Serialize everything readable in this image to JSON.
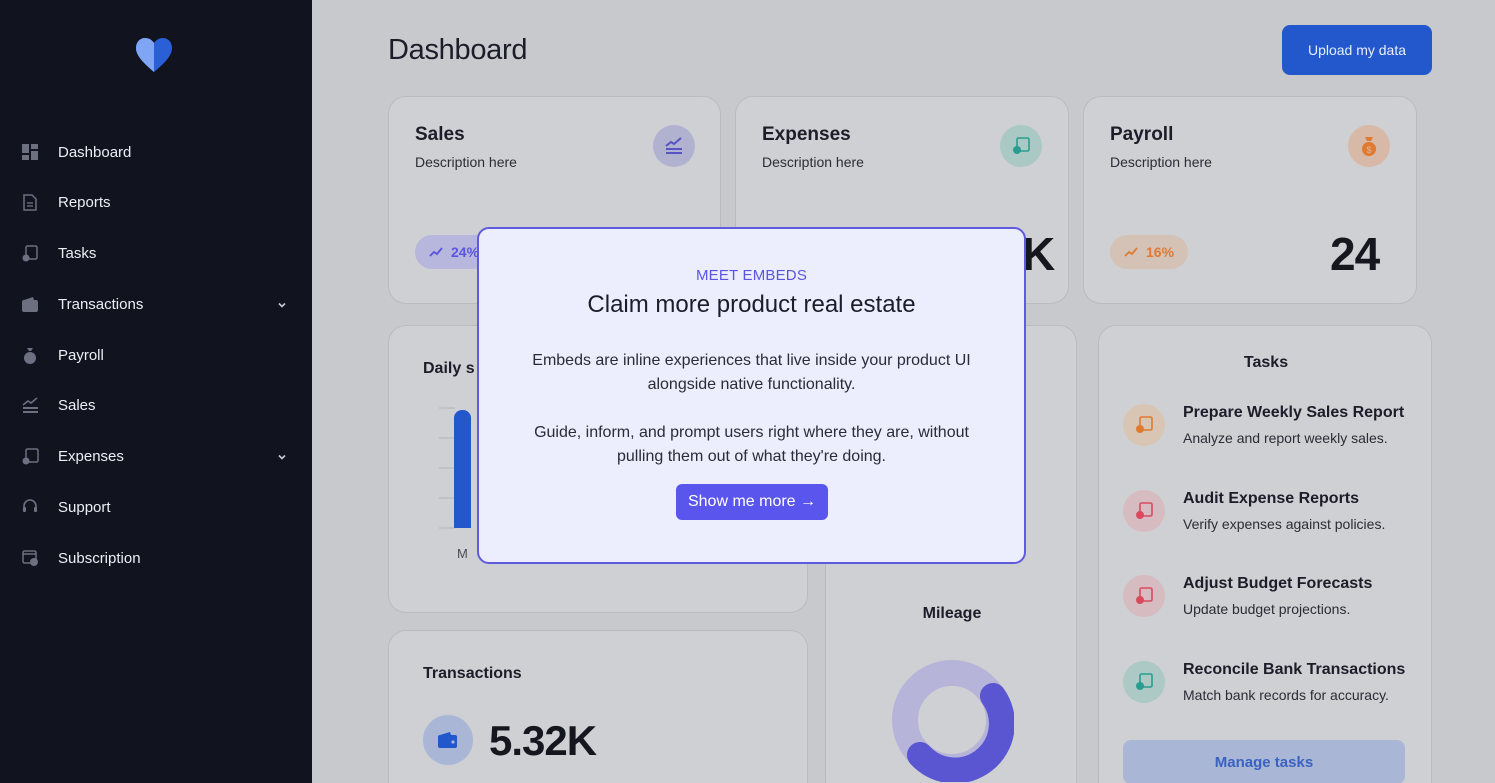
{
  "sidebar": {
    "items": [
      {
        "label": "Dashboard",
        "icon": "dashboard-icon"
      },
      {
        "label": "Reports",
        "icon": "document-icon"
      },
      {
        "label": "Tasks",
        "icon": "tasks-icon"
      },
      {
        "label": "Transactions",
        "icon": "wallet-icon",
        "expandable": true
      },
      {
        "label": "Payroll",
        "icon": "money-bag-icon"
      },
      {
        "label": "Sales",
        "icon": "chart-icon"
      },
      {
        "label": "Expenses",
        "icon": "expenses-icon",
        "expandable": true
      },
      {
        "label": "Support",
        "icon": "headset-icon"
      },
      {
        "label": "Subscription",
        "icon": "subscription-icon"
      }
    ]
  },
  "header": {
    "title": "Dashboard",
    "upload_label": "Upload my data"
  },
  "cards": {
    "sales": {
      "title": "Sales",
      "desc": "Description here",
      "pill": "24%"
    },
    "expenses": {
      "title": "Expenses",
      "desc": "Description here",
      "value_partial": "K"
    },
    "payroll": {
      "title": "Payroll",
      "desc": "Description here",
      "pill": "16%",
      "value": "24"
    }
  },
  "daily_sales": {
    "title_partial": "Daily s",
    "axis_label": "M"
  },
  "transactions": {
    "title": "Transactions",
    "value": "5.32K"
  },
  "mileage": {
    "title": "Mileage"
  },
  "tasks": {
    "title": "Tasks",
    "items": [
      {
        "title": "Prepare Weekly Sales Report",
        "desc": "Analyze and report weekly sales."
      },
      {
        "title": "Audit Expense Reports",
        "desc": "Verify expenses against policies."
      },
      {
        "title": "Adjust Budget Forecasts",
        "desc": "Update budget projections."
      },
      {
        "title": "Reconcile Bank Transactions",
        "desc": "Match bank records for accuracy."
      }
    ],
    "manage_label": "Manage tasks"
  },
  "modal": {
    "eyebrow": "MEET EMBEDS",
    "title": "Claim more product real estate",
    "body1": "Embeds are inline experiences that live inside your product UI alongside native functionality.",
    "body2": "Guide, inform, and prompt users right where they are, without pulling them out of what they're doing.",
    "button": "Show me more →"
  },
  "colors": {
    "sidebar_bg": "#11131f",
    "accent": "#2357cc",
    "modal_accent": "#5a55ec"
  }
}
